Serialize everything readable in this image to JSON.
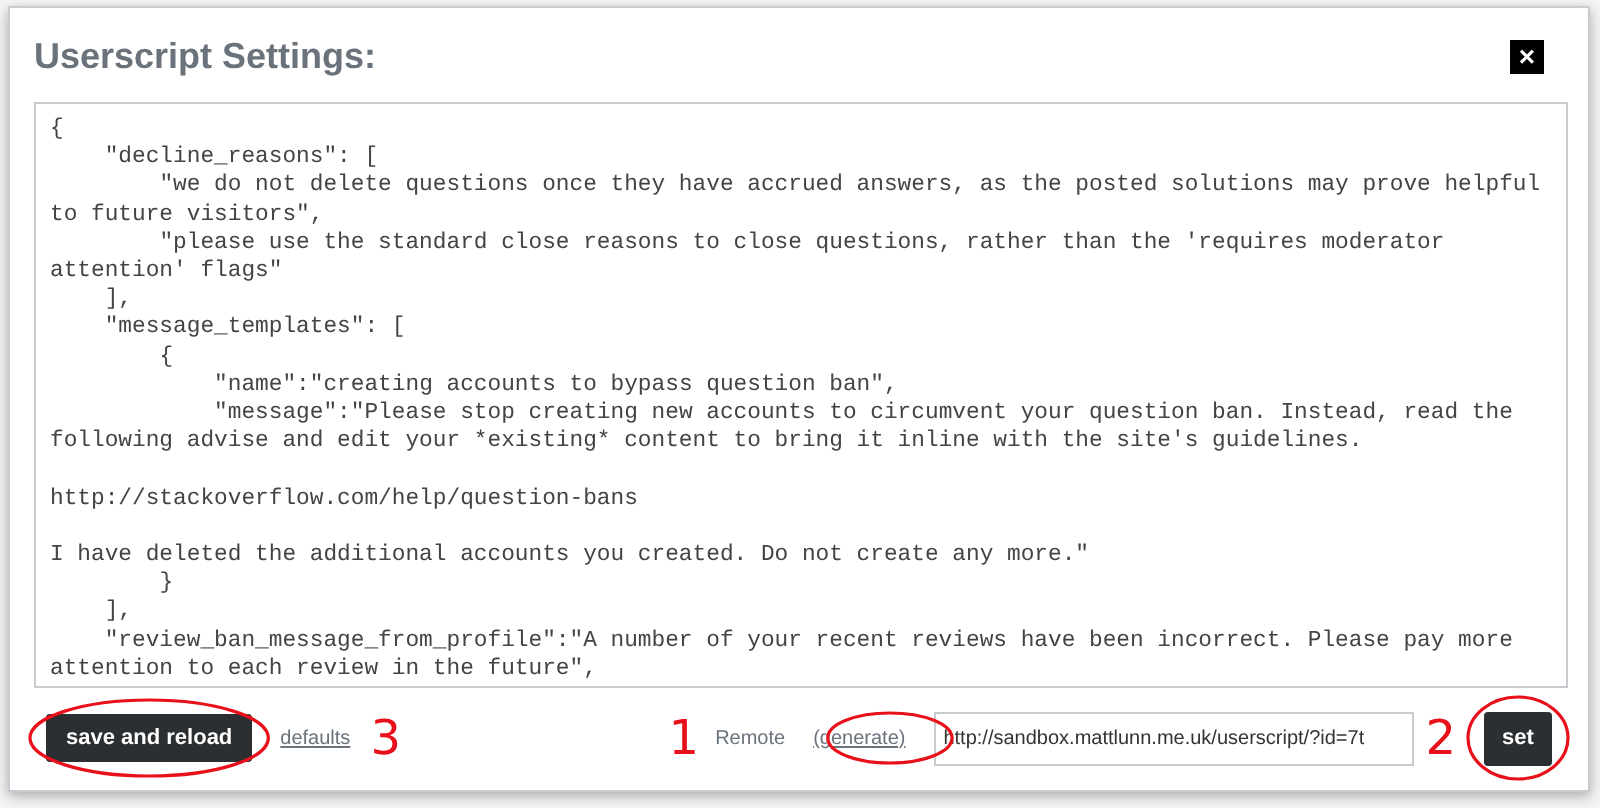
{
  "dialog": {
    "title": "Userscript Settings:",
    "close_label": "×"
  },
  "editor": {
    "value": "{\n    \"decline_reasons\": [\n        \"we do not delete questions once they have accrued answers, as the posted solutions may prove helpful to future visitors\",\n        \"please use the standard close reasons to close questions, rather than the 'requires moderator attention' flags\"\n    ],\n    \"message_templates\": [\n        {\n            \"name\":\"creating accounts to bypass question ban\",\n            \"message\":\"Please stop creating new accounts to circumvent your question ban. Instead, read the following advise and edit your *existing* content to bring it inline with the site's guidelines.\n\nhttp://stackoverflow.com/help/question-bans\n\nI have deleted the additional accounts you created. Do not create any more.\"\n        }\n    ],\n    \"review_ban_message_from_profile\":\"A number of your recent reviews have been incorrect. Please pay more attention to each review in the future\","
  },
  "footer": {
    "save_button": "save and reload",
    "defaults_link": "defaults",
    "remote_label": "Remote",
    "generate_link": "(generate)",
    "remote_url": "http://sandbox.mattlunn.me.uk/userscript/?id=7t",
    "set_button": "set"
  },
  "annotations": [
    {
      "kind": "circle"
    },
    {
      "kind": "circle"
    },
    {
      "kind": "circle"
    },
    {
      "kind": "number",
      "label": "3"
    },
    {
      "kind": "number",
      "label": "1"
    },
    {
      "kind": "number",
      "label": "2"
    }
  ]
}
